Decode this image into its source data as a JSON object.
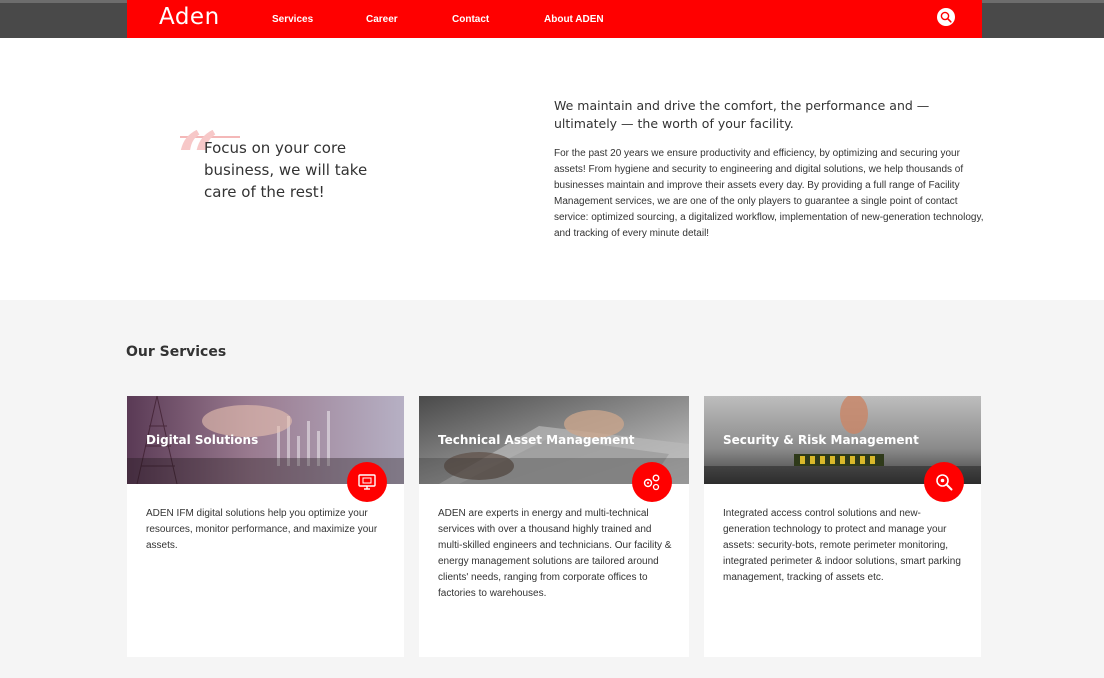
{
  "header": {
    "logo": "Aden",
    "nav": [
      "Services",
      "Career",
      "Contact",
      "About ADEN"
    ],
    "search_icon": "search-icon"
  },
  "intro": {
    "tagline": "Focus on your core business, we will take care of the rest!",
    "lead": "We maintain and drive the comfort, the performance and — ultimately — the worth of your facility.",
    "body": "For the past 20 years we ensure productivity and efficiency, by optimizing and securing your assets! From hygiene and security to engineering and digital solutions, we help thousands of businesses maintain and improve their assets every day. By providing a full range of Facility Management services, we are one of the only players to guarantee a single point of contact service: optimized sourcing, a digitalized workflow, implementation of new-generation technology, and tracking of every minute detail!"
  },
  "services": {
    "title": "Our Services",
    "cards": [
      {
        "title": "Digital Solutions",
        "icon": "monitor-icon",
        "description": "ADEN IFM digital solutions help you optimize your resources, monitor performance, and maximize your assets."
      },
      {
        "title": "Technical Asset Management",
        "icon": "gears-icon",
        "description": "ADEN are experts in energy and multi-technical services with over a thousand highly trained and multi-skilled engineers and technicians. Our facility & energy management solutions are tailored around clients' needs, ranging from corporate offices to factories to warehouses."
      },
      {
        "title": "Security & Risk Management",
        "icon": "magnifier-icon",
        "description": "Integrated access control solutions and new-generation technology  to protect and manage your assets: security-bots, remote perimeter monitoring, integrated perimeter & indoor solutions, smart parking management, tracking of assets etc."
      }
    ]
  },
  "colors": {
    "brand_red": "#ff0000",
    "topbar_gray": "#494949",
    "services_bg": "#f5f5f5"
  }
}
